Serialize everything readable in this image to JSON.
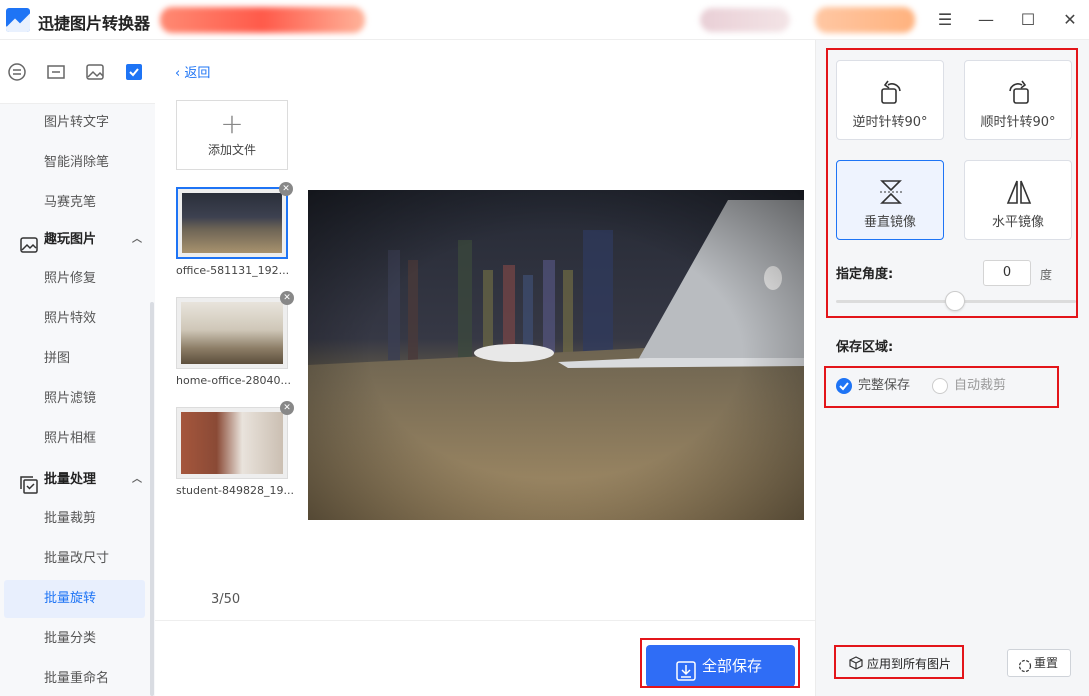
{
  "app": {
    "title": "迅捷图片转换器",
    "window_controls": [
      "menu",
      "minimize",
      "maximize",
      "close"
    ],
    "brand_color": "#1e74f5"
  },
  "sidebar": {
    "tab_icons": [
      "convert-icon",
      "crop-icon",
      "image-icon",
      "batch-icon"
    ],
    "items": [
      {
        "label": "图片转文字",
        "type": "item"
      },
      {
        "label": "智能消除笔",
        "type": "item"
      },
      {
        "label": "马赛克笔",
        "type": "item"
      },
      {
        "label": "趣玩图片",
        "type": "group",
        "icon": "image-icon",
        "expanded": true
      },
      {
        "label": "照片修复",
        "type": "item"
      },
      {
        "label": "照片特效",
        "type": "item"
      },
      {
        "label": "拼图",
        "type": "item"
      },
      {
        "label": "照片滤镜",
        "type": "item"
      },
      {
        "label": "照片相框",
        "type": "item"
      },
      {
        "label": "批量处理",
        "type": "group",
        "icon": "batch-icon",
        "expanded": true
      },
      {
        "label": "批量裁剪",
        "type": "item"
      },
      {
        "label": "批量改尺寸",
        "type": "item"
      },
      {
        "label": "批量旋转",
        "type": "item",
        "active": true
      },
      {
        "label": "批量分类",
        "type": "item"
      },
      {
        "label": "批量重命名",
        "type": "item"
      }
    ]
  },
  "main": {
    "back_label": "返回",
    "add_file_label": "添加文件",
    "files": [
      {
        "name": "office-581131_192...",
        "selected": true
      },
      {
        "name": "home-office-28040...",
        "selected": false
      },
      {
        "name": "student-849828_19...",
        "selected": false
      }
    ],
    "count": "3/50",
    "save_all_label": "全部保存"
  },
  "rotate_panel": {
    "ops": [
      {
        "label": "逆时针转90°",
        "icon": "rotate-ccw-icon",
        "active": false
      },
      {
        "label": "顺时针转90°",
        "icon": "rotate-cw-icon",
        "active": false
      },
      {
        "label": "垂直镜像",
        "icon": "flip-vertical-icon",
        "active": true
      },
      {
        "label": "水平镜像",
        "icon": "flip-horizontal-icon",
        "active": false
      }
    ],
    "angle_label": "指定角度:",
    "angle_value": "0",
    "angle_unit": "度",
    "save_area_label": "保存区域:",
    "save_options": [
      {
        "label": "完整保存",
        "checked": true
      },
      {
        "label": "自动裁剪",
        "checked": false
      }
    ],
    "apply_all_label": "应用到所有图片",
    "reset_label": "重置"
  }
}
